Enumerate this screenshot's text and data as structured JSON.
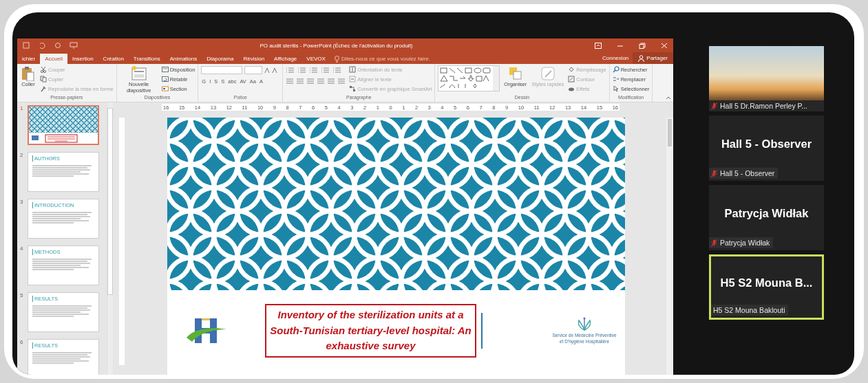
{
  "window": {
    "title": "PO audit sterilis - PowerPoint (Échec de l'activation du produit)"
  },
  "tabs": [
    {
      "label": "ichier",
      "selected": false
    },
    {
      "label": "Accueil",
      "selected": true
    },
    {
      "label": "Insertion",
      "selected": false
    },
    {
      "label": "Création",
      "selected": false
    },
    {
      "label": "Transitions",
      "selected": false
    },
    {
      "label": "Animations",
      "selected": false
    },
    {
      "label": "Diaporama",
      "selected": false
    },
    {
      "label": "Révision",
      "selected": false
    },
    {
      "label": "Affichage",
      "selected": false
    },
    {
      "label": "VEVOX",
      "selected": false
    }
  ],
  "tell_me": {
    "placeholder": "Dites-nous ce que vous voulez faire."
  },
  "account": {
    "sign_in": "Connexion",
    "share": "Partager"
  },
  "ribbon": {
    "groups": [
      {
        "kind": "clipboard",
        "label": "Presse-papiers",
        "large": [
          {
            "label": "Coller",
            "disabled": false
          }
        ],
        "commands": [
          {
            "label": "Couper",
            "disabled": true
          },
          {
            "label": "Copier",
            "disabled": true
          },
          {
            "label": "Reproduire la mise en forme",
            "disabled": true
          }
        ]
      },
      {
        "kind": "slides",
        "label": "Diapositives",
        "large": [
          {
            "label": "Nouvelle diapositive",
            "disabled": false
          }
        ],
        "commands": [
          {
            "label": "Disposition",
            "disabled": false
          },
          {
            "label": "Rétablir",
            "disabled": false
          },
          {
            "label": "Section",
            "disabled": false
          }
        ]
      },
      {
        "kind": "font",
        "label": "Police",
        "font_buttons": [
          "G",
          "I",
          "S",
          "S",
          "abc",
          "AV",
          "Aa",
          "A"
        ]
      },
      {
        "kind": "paragraph",
        "label": "Paragraphe",
        "commands": [
          {
            "label": "Orientation du texte",
            "disabled": true
          },
          {
            "label": "Aligner le texte",
            "disabled": true
          },
          {
            "label": "Convertir en graphique SmartArt",
            "disabled": true
          }
        ]
      },
      {
        "kind": "drawing",
        "label": "Dessin",
        "large": [
          {
            "label": "Organiser",
            "disabled": false
          },
          {
            "label": "Styles rapides",
            "disabled": true
          }
        ],
        "commands": [
          {
            "label": "Remplissage",
            "disabled": true
          },
          {
            "label": "Contour",
            "disabled": true
          },
          {
            "label": "Effets",
            "disabled": true
          }
        ]
      },
      {
        "kind": "editing",
        "label": "Modification",
        "commands": [
          {
            "label": "Rechercher",
            "disabled": false
          },
          {
            "label": "Remplacer",
            "disabled": false
          },
          {
            "label": "Sélectionner",
            "disabled": false
          }
        ]
      }
    ]
  },
  "ruler": {
    "labels": [
      "16",
      "15",
      "14",
      "13",
      "12",
      "11",
      "10",
      "9",
      "8",
      "7",
      "6",
      "5",
      "4",
      "3",
      "2",
      "1",
      "0",
      "1",
      "2",
      "3",
      "4",
      "5",
      "6",
      "7",
      "8",
      "9",
      "10",
      "11",
      "12",
      "13",
      "14",
      "15",
      "16"
    ]
  },
  "thumbnails": [
    {
      "number": "1",
      "kind": "title",
      "selected": true
    },
    {
      "number": "2",
      "kind": "text",
      "heading": "AUTHORS",
      "selected": false
    },
    {
      "number": "3",
      "kind": "text",
      "heading": "INTRODUCTION",
      "selected": false
    },
    {
      "number": "4",
      "kind": "text",
      "heading": "METHODS",
      "selected": false
    },
    {
      "number": "5",
      "kind": "text",
      "heading": "RESULTS",
      "selected": false
    },
    {
      "number": "6",
      "kind": "text",
      "heading": "RESULTS",
      "selected": false
    }
  ],
  "slide": {
    "title": "Inventory of the sterilization units at a South-Tunisian tertiary-level hospital: An exhaustive survey",
    "logo_caption": "Service de Médecine Préventive et D'hygiène Hospitalière"
  },
  "participants": [
    {
      "kind": "video",
      "name": "Hall 5 Dr.Ramon Perley P...",
      "muted": true,
      "active": false
    },
    {
      "kind": "name",
      "display_name": "Hall 5 - Observer",
      "name": "Hall 5 - Observer",
      "muted": true,
      "active": false
    },
    {
      "kind": "name",
      "display_name": "Patrycja Widłak",
      "name": "Patrycja Widłak",
      "muted": true,
      "active": false
    },
    {
      "kind": "name",
      "display_name": "H5 S2 Mouna B...",
      "name": "H5 S2 Mouna Baklouti",
      "muted": false,
      "active": true
    }
  ]
}
